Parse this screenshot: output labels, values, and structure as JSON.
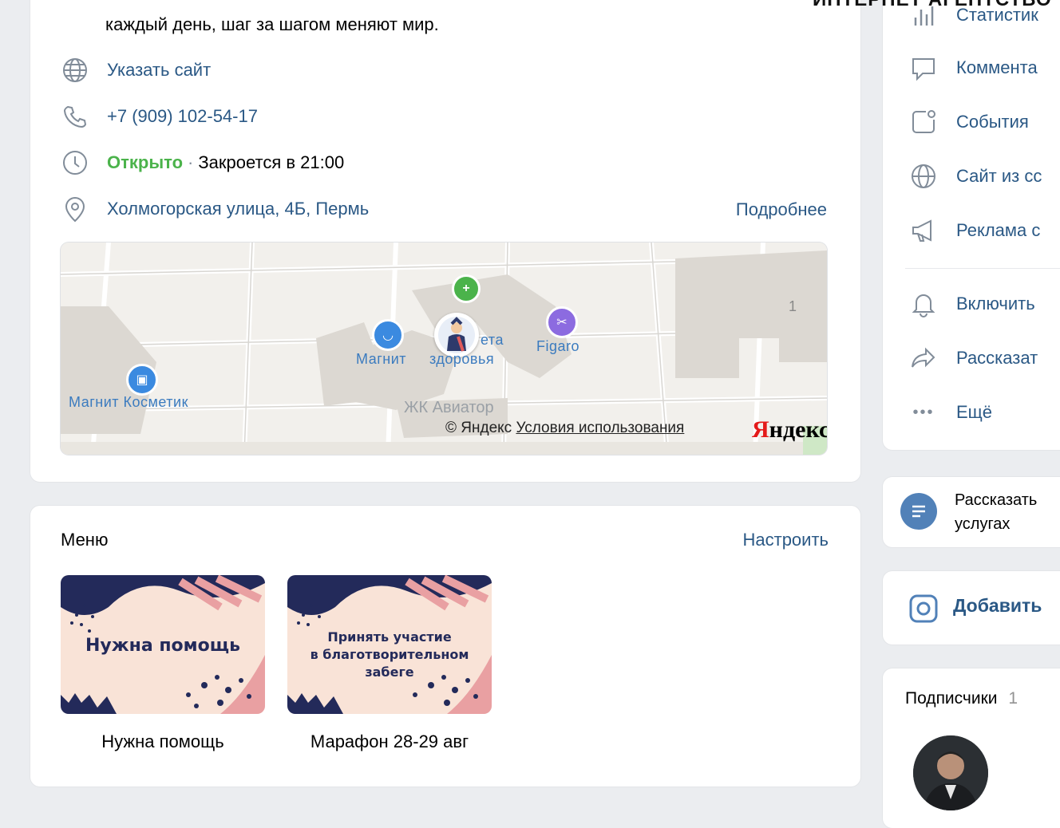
{
  "watermark": "ИНТЕРНЕТ АГЕНТСТВО",
  "info": {
    "description_line": "каждый день, шаг за шагом меняют мир.",
    "website": "Указать сайт",
    "phone": "+7 (909) 102-54-17",
    "status_open": "Открыто",
    "status_close": "Закроется в 21:00",
    "address": "Холмогорская улица, 4Б, Пермь",
    "more": "Подробнее"
  },
  "map": {
    "labels": {
      "magnit_kosmetik": "Магнит Косметик",
      "magnit": "Магнит",
      "place_line1": "ета",
      "place_line2": "здоровья",
      "figaro": "Figaro",
      "zhk": "ЖК Авиатор",
      "house_number": "1"
    },
    "copyright": "© Яндекс",
    "terms": "Условия использования",
    "logo_first": "Я",
    "logo_rest": "ндекс"
  },
  "menu": {
    "title": "Меню",
    "action": "Настроить",
    "items": [
      {
        "thumb_text": "Нужна помощь",
        "caption": "Нужна помощь"
      },
      {
        "thumb_line1": "Принять участие",
        "thumb_line2": "в благотворительном",
        "thumb_line3": "забеге",
        "caption": "Марафон 28-29 авг"
      }
    ]
  },
  "side": {
    "items": [
      {
        "label": "Статистик",
        "icon": "stats-icon"
      },
      {
        "label": "Коммента",
        "icon": "comment-icon"
      },
      {
        "label": "События",
        "icon": "events-icon"
      },
      {
        "label": "Сайт из сс",
        "icon": "globe-icon"
      },
      {
        "label": "Реклама с",
        "icon": "megaphone-icon"
      },
      {
        "label": "Включить",
        "icon": "bell-icon"
      },
      {
        "label": "Рассказат",
        "icon": "share-icon"
      },
      {
        "label": "Ещё",
        "icon": "more-icon"
      }
    ]
  },
  "tell": {
    "line1": "Рассказать",
    "line2": "услугах"
  },
  "add": {
    "label": "Добавить"
  },
  "subscribers": {
    "title": "Подписчики",
    "count": "1"
  },
  "colors": {
    "link": "#2a5885",
    "open": "#4bb34b",
    "icon": "#818c99",
    "accent": "#5181b8"
  }
}
